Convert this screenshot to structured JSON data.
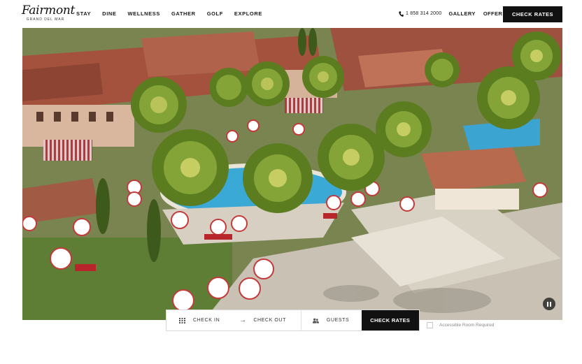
{
  "brand": {
    "name": "Fairmont",
    "subtitle": "GRAND DEL MAR"
  },
  "nav": {
    "items": [
      "STAY",
      "DINE",
      "WELLNESS",
      "GATHER",
      "GOLF",
      "EXPLORE"
    ]
  },
  "header_right": {
    "phone": "1 858 314 2000",
    "gallery": "GALLERY",
    "offers": "OFFERS",
    "check_rates": "CHECK RATES"
  },
  "booking": {
    "check_in": "CHECK IN",
    "check_out": "CHECK OUT",
    "guests": "GUESTS",
    "check_rates": "CHECK RATES",
    "accessible_label": "Accessible Room Required"
  },
  "colors": {
    "button_bg": "#111111",
    "pool": "#3aa9d6",
    "roof": "#a55a44"
  }
}
